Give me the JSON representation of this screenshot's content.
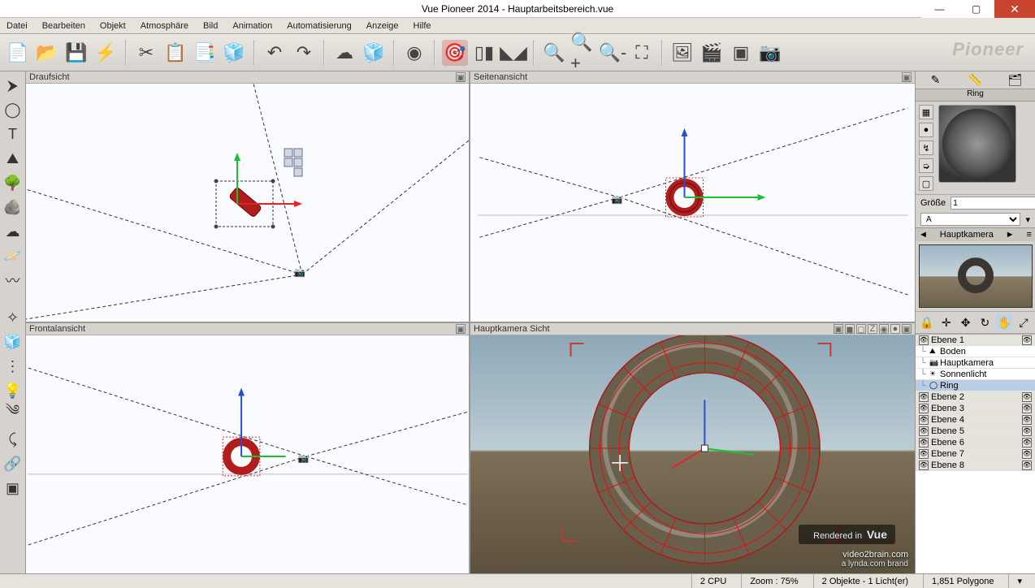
{
  "app": {
    "title": "Vue Pioneer 2014 - Hauptarbeitsbereich.vue",
    "brand": "Pioneer"
  },
  "window": {
    "minimize_label": "—",
    "maximize_label": "▢",
    "close_label": "✕"
  },
  "menu": {
    "items": [
      "Datei",
      "Bearbeiten",
      "Objekt",
      "Atmosphäre",
      "Bild",
      "Animation",
      "Automatisierung",
      "Anzeige",
      "Hilfe"
    ]
  },
  "toolbar": {
    "icons": [
      {
        "name": "new-file-icon",
        "glyph": "📄"
      },
      {
        "name": "open-folder-icon",
        "glyph": "📂"
      },
      {
        "name": "save-icon",
        "glyph": "💾"
      },
      {
        "name": "quick-render-icon",
        "glyph": "⚡"
      },
      {
        "sep": true
      },
      {
        "name": "cut-icon",
        "glyph": "✂"
      },
      {
        "name": "copy-icon",
        "glyph": "📋"
      },
      {
        "name": "paste-icon",
        "glyph": "📑"
      },
      {
        "name": "duplicate-icon",
        "glyph": "🧊"
      },
      {
        "sep": true
      },
      {
        "name": "undo-icon",
        "glyph": "↶"
      },
      {
        "name": "redo-icon",
        "glyph": "↷"
      },
      {
        "sep": true
      },
      {
        "name": "atmosphere-icon",
        "glyph": "☁"
      },
      {
        "name": "material-icon",
        "glyph": "🧊"
      },
      {
        "sep": true
      },
      {
        "name": "ecosystem-icon",
        "glyph": "◉"
      },
      {
        "sep": true
      },
      {
        "name": "render-icon",
        "glyph": "🎯",
        "active": true
      },
      {
        "name": "render-options-icon",
        "glyph": "▯▮"
      },
      {
        "name": "mirror-icon",
        "glyph": "◣◢"
      },
      {
        "sep": true
      },
      {
        "name": "zoom-fit-icon",
        "glyph": "🔍"
      },
      {
        "name": "zoom-in-icon",
        "glyph": "🔍+"
      },
      {
        "name": "zoom-out-icon",
        "glyph": "🔍-"
      },
      {
        "name": "zoom-extents-icon",
        "glyph": "⛶"
      },
      {
        "sep": true
      },
      {
        "name": "picture-icon",
        "glyph": "🖼"
      },
      {
        "name": "clapboard-icon",
        "glyph": "🎬"
      },
      {
        "name": "frame-icon",
        "glyph": "▣"
      },
      {
        "name": "camera-icon",
        "glyph": "📷"
      }
    ]
  },
  "leftbar": {
    "group1": [
      {
        "name": "select-tool-icon",
        "glyph": "⮞"
      },
      {
        "name": "sphere-tool-icon",
        "glyph": "◯"
      },
      {
        "name": "text-tool-icon",
        "glyph": "T"
      },
      {
        "name": "terrain-tool-icon",
        "glyph": "⛰"
      },
      {
        "name": "plant-tool-icon",
        "glyph": "🌳"
      },
      {
        "name": "rock-tool-icon",
        "glyph": "🪨"
      },
      {
        "name": "cloud-tool-icon",
        "glyph": "☁"
      },
      {
        "name": "planet-tool-icon",
        "glyph": "🪐"
      },
      {
        "name": "wave-tool-icon",
        "glyph": "〰"
      }
    ],
    "group2": [
      {
        "name": "gizmo-tool-icon",
        "glyph": "✧"
      },
      {
        "name": "cube-tool-icon",
        "glyph": "🧊"
      },
      {
        "name": "dots-tool-icon",
        "glyph": "⋮"
      },
      {
        "name": "light-tool-icon",
        "glyph": "💡"
      },
      {
        "name": "wind-tool-icon",
        "glyph": "༄"
      },
      {
        "name": "curve-tool-icon",
        "glyph": "⤹"
      },
      {
        "name": "link-tool-icon",
        "glyph": "🔗"
      },
      {
        "name": "group-tool-icon",
        "glyph": "▣"
      }
    ]
  },
  "viewports": {
    "top": {
      "label": "Draufsicht"
    },
    "side": {
      "label": "Seitenansicht"
    },
    "front": {
      "label": "Frontalansicht"
    },
    "camera": {
      "label": "Hauptkamera Sicht"
    }
  },
  "right": {
    "tabs": [
      {
        "name": "tab-edit-icon",
        "glyph": "✎"
      },
      {
        "name": "tab-measure-icon",
        "glyph": "📏"
      },
      {
        "name": "tab-library-icon",
        "glyph": "🗂"
      }
    ],
    "object_name": "Ring",
    "mat_btns": [
      {
        "name": "mat-checker-icon",
        "glyph": "▦"
      },
      {
        "name": "mat-sphere-icon",
        "glyph": "●"
      },
      {
        "name": "mat-convert-icon",
        "glyph": "↯"
      },
      {
        "name": "mat-bump-icon",
        "glyph": "➭"
      },
      {
        "name": "mat-cube-icon",
        "glyph": "▢"
      }
    ],
    "size_label": "Größe",
    "size_value": "1",
    "aspect_value": "A",
    "camera_label": "Hauptkamera",
    "arrow_left": "◄",
    "arrow_right": "►",
    "gizmo_row": [
      {
        "name": "gizmo-lock-icon",
        "glyph": "🔒"
      },
      {
        "name": "gizmo-axis-icon",
        "glyph": "✛"
      },
      {
        "name": "gizmo-move-icon",
        "glyph": "✥"
      },
      {
        "name": "gizmo-rotate-icon",
        "glyph": "↻"
      },
      {
        "name": "gizmo-hand-icon",
        "glyph": "✋",
        "sel": true
      },
      {
        "name": "gizmo-scale-icon",
        "glyph": "⤢"
      }
    ],
    "layers": [
      {
        "name": "Ebene 1",
        "expanded": true,
        "head": true,
        "children": [
          {
            "name": "Boden",
            "icon": "⛰"
          },
          {
            "name": "Hauptkamera",
            "icon": "📷"
          },
          {
            "name": "Sonnenlicht",
            "icon": "☀"
          },
          {
            "name": "Ring",
            "icon": "◯",
            "selected": true
          }
        ]
      },
      {
        "name": "Ebene 2",
        "head": true
      },
      {
        "name": "Ebene 3",
        "head": true
      },
      {
        "name": "Ebene 4",
        "head": true
      },
      {
        "name": "Ebene 5",
        "head": true
      },
      {
        "name": "Ebene 6",
        "head": true
      },
      {
        "name": "Ebene 7",
        "head": true
      },
      {
        "name": "Ebene 8",
        "head": true
      }
    ]
  },
  "status": {
    "cpu": "2 CPU",
    "zoom": "Zoom : 75%",
    "objects": "2 Objekte - 1 Licht(er)",
    "polys": "1,851 Polygone"
  },
  "watermark": {
    "line1": "video2brain.com",
    "line2": "a lynda.com brand"
  },
  "vue_badge": {
    "small": "Rendered in",
    "big": "Vue"
  }
}
